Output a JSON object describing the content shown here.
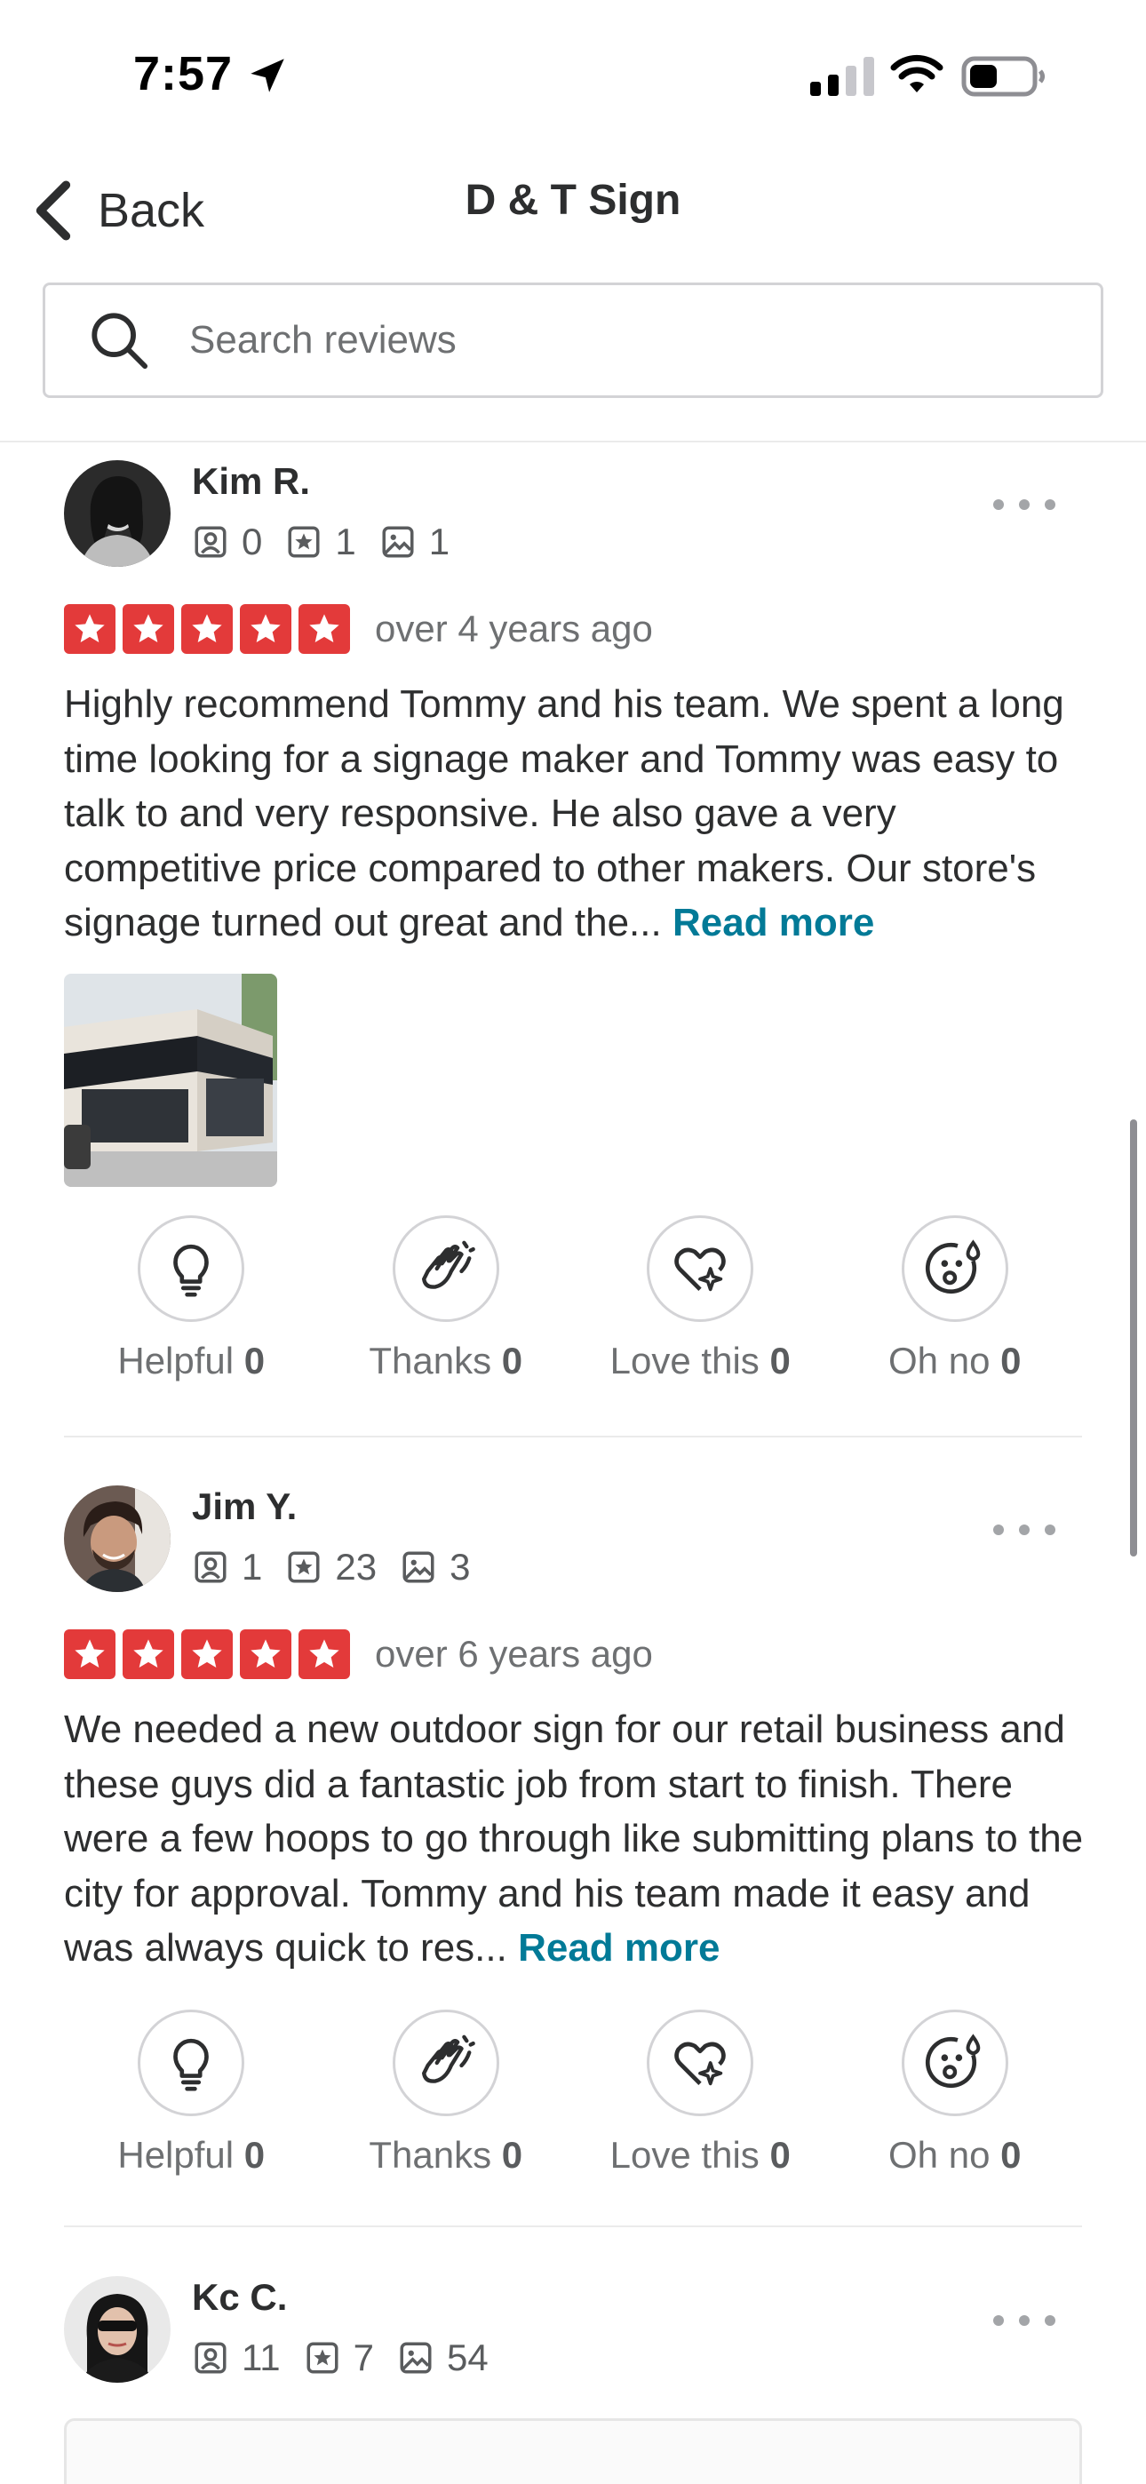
{
  "status_bar": {
    "time": "7:57"
  },
  "nav": {
    "back_label": "Back",
    "title": "D & T Sign"
  },
  "search": {
    "placeholder": "Search reviews",
    "value": ""
  },
  "colors": {
    "star_red": "#e33a3a",
    "link_teal": "#027a97"
  },
  "reviews": [
    {
      "name": "Kim R.",
      "friends": "0",
      "reviews_count": "1",
      "photos": "1",
      "rating": 5,
      "date": "over 4 years ago",
      "text": "Highly recommend Tommy and his team. We spent a long time looking for a signage maker and Tommy was easy to talk to and very responsive.  He also gave a very competitive price compared to other makers. Our store's signage turned out great and the... ",
      "read_more": "Read more",
      "has_photo": true,
      "reactions": [
        {
          "label": "Helpful",
          "count": "0",
          "icon": "lightbulb-icon"
        },
        {
          "label": "Thanks",
          "count": "0",
          "icon": "clapping-hands-icon"
        },
        {
          "label": "Love this",
          "count": "0",
          "icon": "heart-sparkle-icon"
        },
        {
          "label": "Oh no",
          "count": "0",
          "icon": "surprised-face-icon"
        }
      ]
    },
    {
      "name": "Jim Y.",
      "friends": "1",
      "reviews_count": "23",
      "photos": "3",
      "rating": 5,
      "date": "over 6 years ago",
      "text": "We needed a new outdoor sign for our retail business and these guys did a fantastic job from start to finish. There were a few hoops to go through like submitting plans to the city for approval. Tommy and his team made it easy and was always quick to res... ",
      "read_more": "Read more",
      "has_photo": false,
      "reactions": [
        {
          "label": "Helpful",
          "count": "0",
          "icon": "lightbulb-icon"
        },
        {
          "label": "Thanks",
          "count": "0",
          "icon": "clapping-hands-icon"
        },
        {
          "label": "Love this",
          "count": "0",
          "icon": "heart-sparkle-icon"
        },
        {
          "label": "Oh no",
          "count": "0",
          "icon": "surprised-face-icon"
        }
      ]
    },
    {
      "name": "Kc C.",
      "friends": "11",
      "reviews_count": "7",
      "photos": "54"
    }
  ]
}
